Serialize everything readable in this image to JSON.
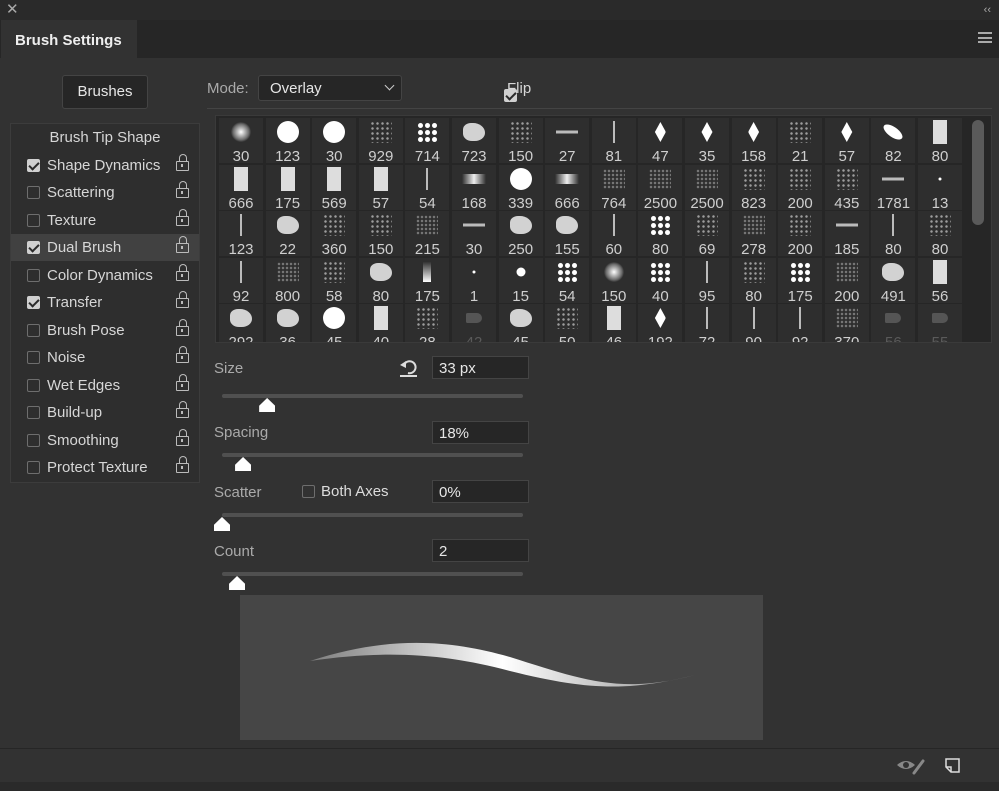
{
  "window": {
    "close_icon": "close-icon",
    "collapse_icon": "double-chevron-left-icon"
  },
  "tab": {
    "title": "Brush Settings",
    "menu_icon": "hamburger-menu-icon"
  },
  "brushes_button": "Brushes",
  "mode": {
    "label": "Mode:",
    "value": "Overlay"
  },
  "flip": {
    "label": "Flip",
    "checked": true
  },
  "sidebar": {
    "header": "Brush Tip Shape",
    "items": [
      {
        "label": "Shape Dynamics",
        "checked": true,
        "selected": false
      },
      {
        "label": "Scattering",
        "checked": false,
        "selected": false
      },
      {
        "label": "Texture",
        "checked": false,
        "selected": false
      },
      {
        "label": "Dual Brush",
        "checked": true,
        "selected": true
      },
      {
        "label": "Color Dynamics",
        "checked": false,
        "selected": false
      },
      {
        "label": "Transfer",
        "checked": true,
        "selected": false
      },
      {
        "label": "Brush Pose",
        "checked": false,
        "selected": false
      },
      {
        "label": "Noise",
        "checked": false,
        "selected": false
      },
      {
        "label": "Wet Edges",
        "checked": false,
        "selected": false
      },
      {
        "label": "Build-up",
        "checked": false,
        "selected": false
      },
      {
        "label": "Smoothing",
        "checked": false,
        "selected": false
      },
      {
        "label": "Protect Texture",
        "checked": false,
        "selected": false
      }
    ]
  },
  "brush_grid": [
    [
      "30",
      "soft"
    ],
    [
      "123",
      "round"
    ],
    [
      "30",
      "round"
    ],
    [
      "929",
      "speck"
    ],
    [
      "714",
      "dots"
    ],
    [
      "723",
      "blob"
    ],
    [
      "150",
      "speck"
    ],
    [
      "27",
      "hline"
    ],
    [
      "81",
      "line"
    ],
    [
      "47",
      "diamond"
    ],
    [
      "35",
      "diamond"
    ],
    [
      "158",
      "diamond"
    ],
    [
      "21",
      "speck"
    ],
    [
      "57",
      "diamond"
    ],
    [
      "82",
      "ellipse"
    ],
    [
      "80",
      "rect"
    ],
    [
      "666",
      "rect"
    ],
    [
      "175",
      "rect"
    ],
    [
      "569",
      "rect"
    ],
    [
      "57",
      "rect"
    ],
    [
      "54",
      "line"
    ],
    [
      "168",
      "stroke"
    ],
    [
      "339",
      "round"
    ],
    [
      "666",
      "stroke"
    ],
    [
      "764",
      "faint"
    ],
    [
      "2500",
      "faint"
    ],
    [
      "2500",
      "faint"
    ],
    [
      "823",
      "speck"
    ],
    [
      "200",
      "speck"
    ],
    [
      "435",
      "speck"
    ],
    [
      "1781",
      "hline"
    ],
    [
      "13",
      "tiny"
    ],
    [
      "123",
      "line"
    ],
    [
      "22",
      "blob"
    ],
    [
      "360",
      "speck"
    ],
    [
      "150",
      "speck"
    ],
    [
      "215",
      "faint"
    ],
    [
      "30",
      "hline"
    ],
    [
      "250",
      "blob"
    ],
    [
      "155",
      "blob"
    ],
    [
      "60",
      "line"
    ],
    [
      "80",
      "dots"
    ],
    [
      "69",
      "speck"
    ],
    [
      "278",
      "faint"
    ],
    [
      "200",
      "speck"
    ],
    [
      "185",
      "hline"
    ],
    [
      "80",
      "line"
    ],
    [
      "80",
      "speck"
    ],
    [
      "92",
      "line"
    ],
    [
      "800",
      "faint"
    ],
    [
      "58",
      "speck"
    ],
    [
      "80",
      "blob"
    ],
    [
      "175",
      "grad"
    ],
    [
      "1",
      "tiny"
    ],
    [
      "15",
      "dot"
    ],
    [
      "54",
      "dots"
    ],
    [
      "150",
      "soft"
    ],
    [
      "40",
      "dots"
    ],
    [
      "95",
      "line"
    ],
    [
      "80",
      "speck"
    ],
    [
      "175",
      "dots"
    ],
    [
      "200",
      "faint"
    ],
    [
      "491",
      "blob"
    ],
    [
      "56",
      "rect"
    ],
    [
      "292",
      "blob"
    ],
    [
      "36",
      "blob"
    ],
    [
      "45",
      "round"
    ],
    [
      "40",
      "rect"
    ],
    [
      "28",
      "speck"
    ],
    [
      "42",
      "dimtip",
      true
    ],
    [
      "45",
      "blob"
    ],
    [
      "50",
      "speck"
    ],
    [
      "46",
      "rect"
    ],
    [
      "192",
      "diamond"
    ],
    [
      "72",
      "line"
    ],
    [
      "90",
      "line"
    ],
    [
      "92",
      "line"
    ],
    [
      "370",
      "faint"
    ],
    [
      "56",
      "dimtip",
      true
    ],
    [
      "55",
      "dimtip",
      true
    ]
  ],
  "controls": {
    "size": {
      "label": "Size",
      "value": "33 px",
      "slider_percent": 15,
      "reset_icon": "reset-icon"
    },
    "spacing": {
      "label": "Spacing",
      "value": "18%",
      "slider_percent": 7
    },
    "scatter": {
      "label": "Scatter",
      "value": "0%",
      "slider_percent": 0,
      "both_axes_label": "Both Axes",
      "both_axes_checked": false
    },
    "count": {
      "label": "Count",
      "value": "2",
      "slider_percent": 5
    }
  },
  "footer": {
    "toggle_preview_icon": "eye-brush-icon",
    "new_brush_icon": "new-page-icon"
  }
}
